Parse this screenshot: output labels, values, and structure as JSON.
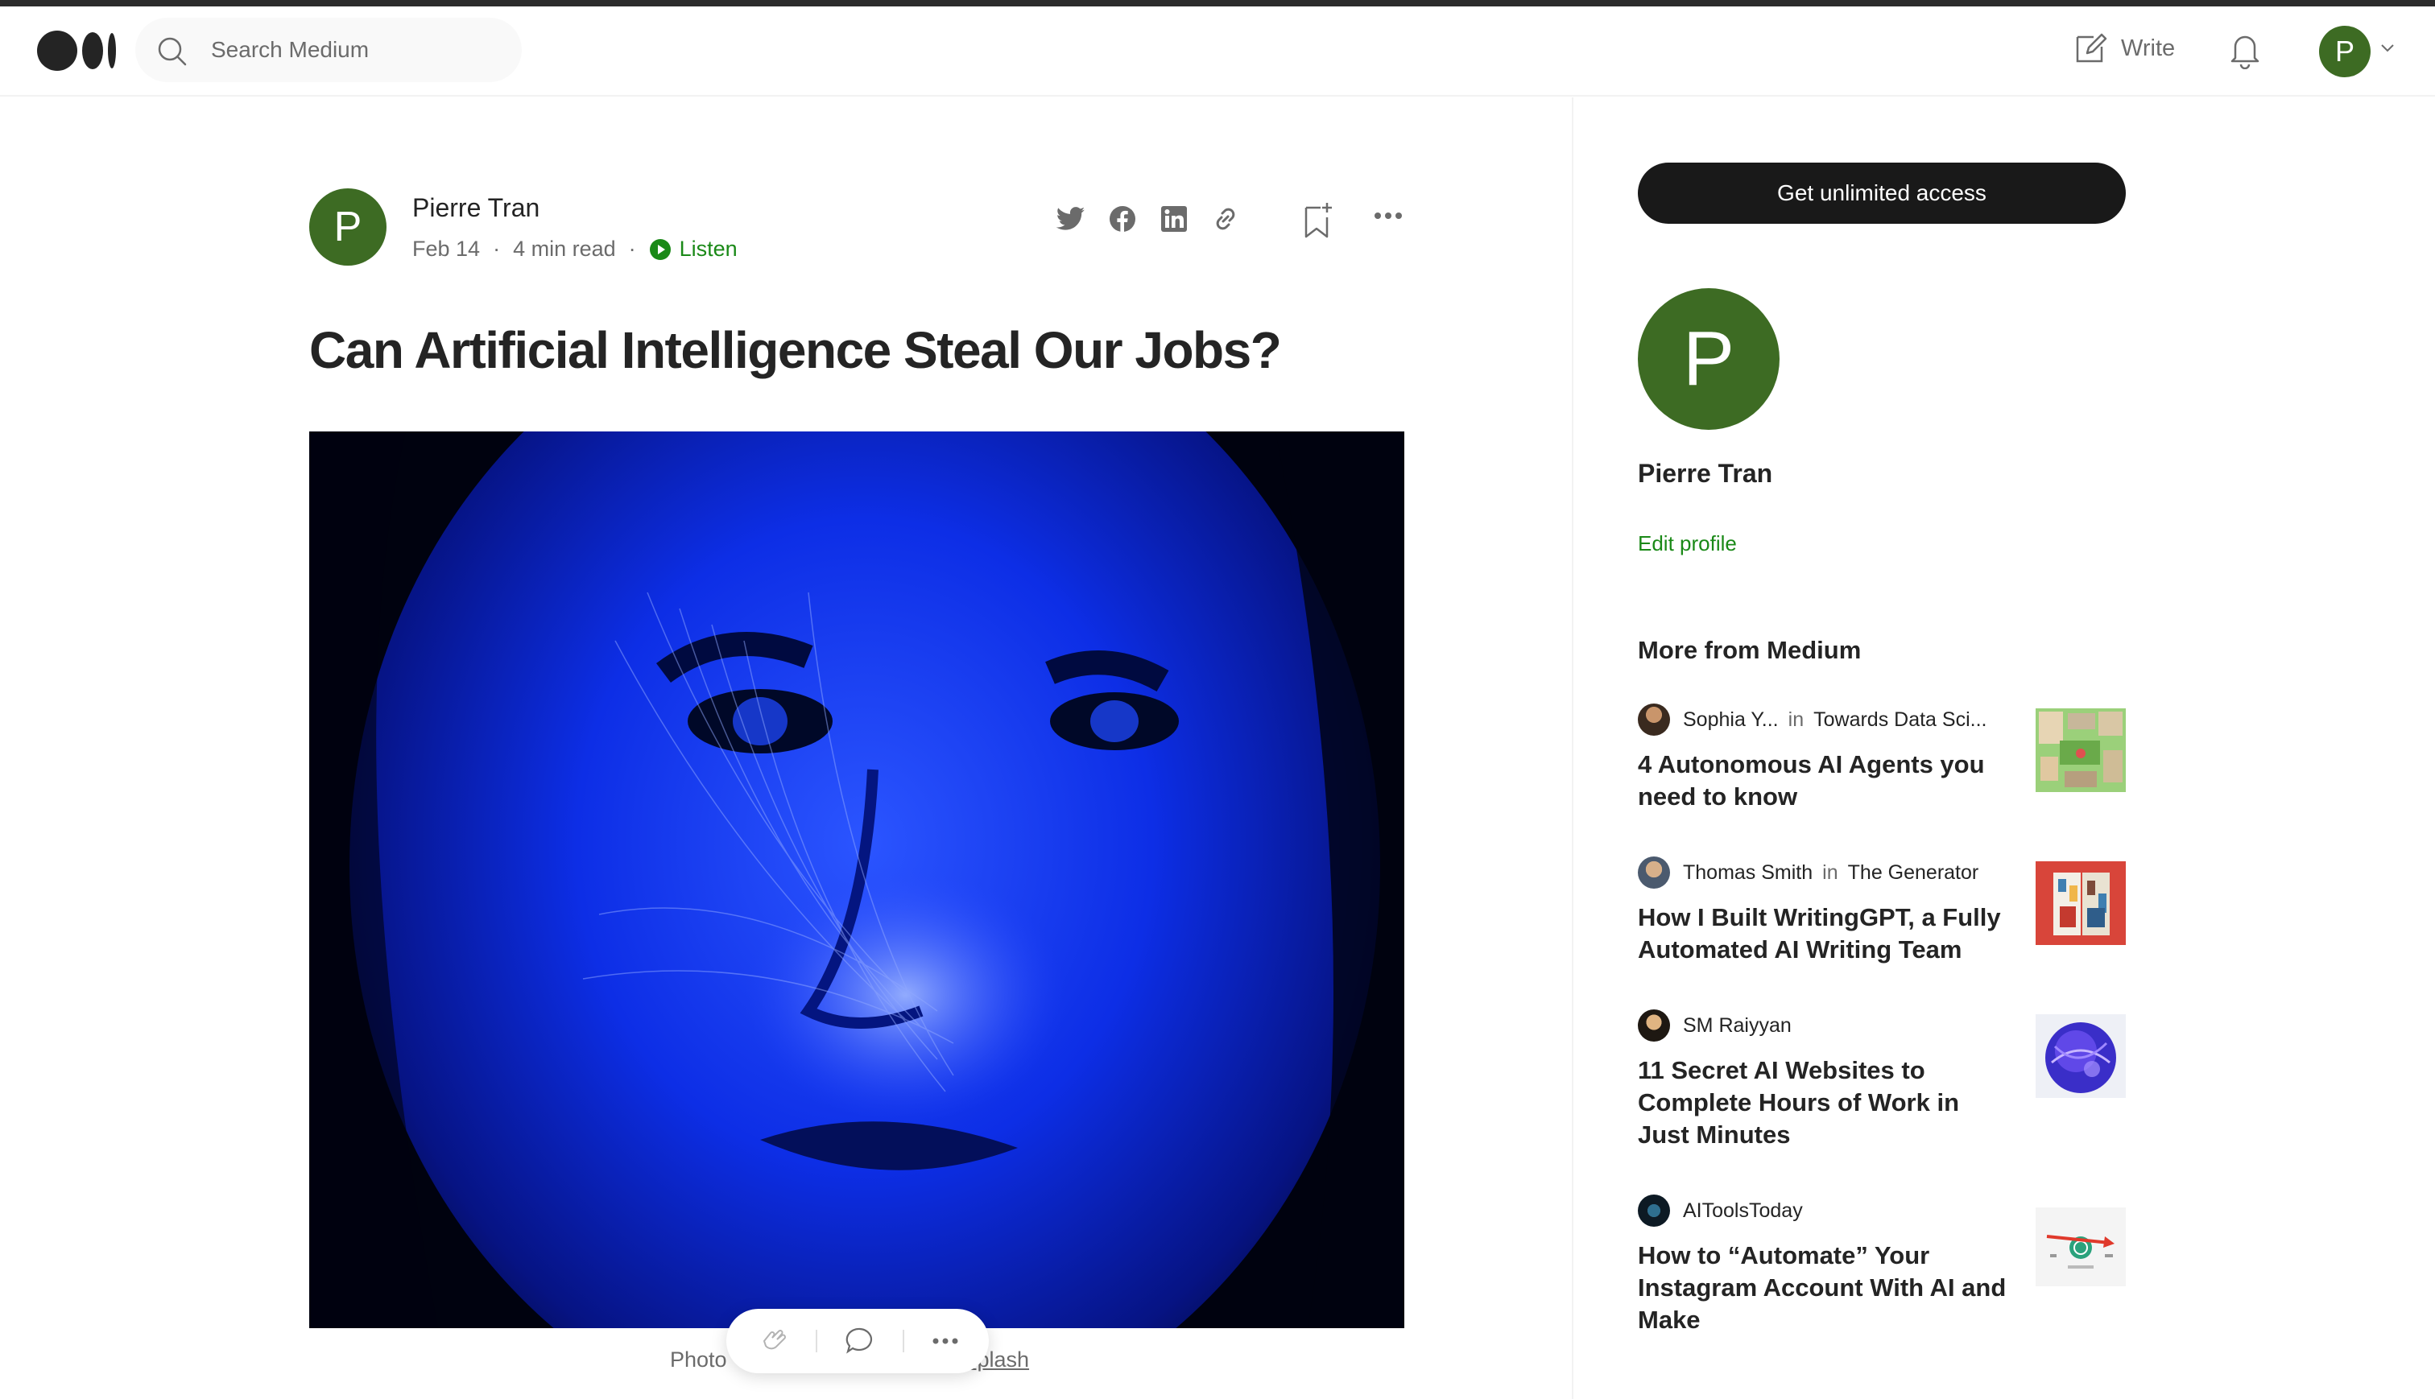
{
  "header": {
    "search_placeholder": "Search Medium",
    "write_label": "Write",
    "avatar_initial": "P"
  },
  "article": {
    "author_initial": "P",
    "author_name": "Pierre Tran",
    "date": "Feb 14",
    "read_time": "4 min read",
    "listen_label": "Listen",
    "title": "Can Artificial Intelligence Steal Our Jobs?",
    "caption_prefix": "Photo",
    "caption_link": "splash"
  },
  "sidebar": {
    "cta_label": "Get unlimited access",
    "profile_initial": "P",
    "profile_name": "Pierre Tran",
    "edit_profile": "Edit profile",
    "more_heading": "More from Medium",
    "items": [
      {
        "author": "Sophia Y...",
        "in": "in",
        "publication": "Towards Data Sci...",
        "title": "4 Autonomous AI Agents you need to know"
      },
      {
        "author": "Thomas Smith",
        "in": "in",
        "publication": "The Generator",
        "title": "How I Built WritingGPT, a Fully Automated AI Writing Team"
      },
      {
        "author": "SM Raiyyan",
        "in": "",
        "publication": "",
        "title": "11 Secret AI Websites to Complete Hours of Work in Just Minutes"
      },
      {
        "author": "AIToolsToday",
        "in": "",
        "publication": "",
        "title": "How to “Automate” Your Instagram Account With AI and Make"
      }
    ]
  },
  "colors": {
    "accent_green": "#1a8917",
    "avatar_green": "#3d6b23",
    "cta_black": "#191919"
  }
}
